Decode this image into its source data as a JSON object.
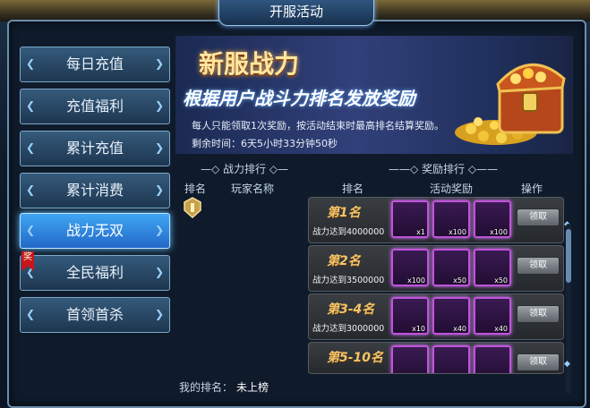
{
  "window": {
    "title": "开服活动"
  },
  "sidebar": {
    "items": [
      {
        "label": "每日充值",
        "active": false
      },
      {
        "label": "充值福利",
        "active": false
      },
      {
        "label": "累计充值",
        "active": false
      },
      {
        "label": "累计消费",
        "active": false
      },
      {
        "label": "战力无双",
        "active": true
      },
      {
        "label": "全民福利",
        "active": false,
        "badge": "奖"
      },
      {
        "label": "首领首杀",
        "active": false
      }
    ]
  },
  "banner": {
    "title": "新服战力",
    "subtitle": "根据用户战斗力排名发放奖励",
    "desc": "每人只能领取1次奖励，按活动结束时最高排名结算奖励。",
    "remaining_label": "剩余时间：",
    "remaining_value": "6天5小时33分钟50秒"
  },
  "left_panel": {
    "section_title": "战力排行",
    "col_rank": "排名",
    "col_player": "玩家名称"
  },
  "reward_panel": {
    "section_title": "奖励排行",
    "col_rank": "排名",
    "col_reward": "活动奖励",
    "col_action": "操作",
    "rows": [
      {
        "rank": "第1名",
        "requirement": "战力达到4000000",
        "items": [
          {
            "icon": "hero-portrait-icon",
            "count": "x1"
          },
          {
            "icon": "gold-gem-icon",
            "count": "x100"
          },
          {
            "icon": "green-gem-icon",
            "count": "x100"
          }
        ],
        "action": "领取"
      },
      {
        "rank": "第2名",
        "requirement": "战力达到3500000",
        "items": [
          {
            "icon": "red-book-icon",
            "count": "x100"
          },
          {
            "icon": "gold-gem-icon",
            "count": "x50"
          },
          {
            "icon": "green-gem-icon",
            "count": "x50"
          }
        ],
        "action": "领取"
      },
      {
        "rank": "第3-4名",
        "requirement": "战力达到3000000",
        "items": [
          {
            "icon": "orange-shield-icon",
            "count": "x10"
          },
          {
            "icon": "gold-gem-icon",
            "count": "x40"
          },
          {
            "icon": "green-gem-icon",
            "count": "x40"
          }
        ],
        "action": "领取"
      },
      {
        "rank": "第5-10名",
        "requirement": "",
        "items": [
          {
            "icon": "red-armor-icon",
            "count": ""
          },
          {
            "icon": "gold-gem-icon",
            "count": ""
          },
          {
            "icon": "green-gem-icon",
            "count": ""
          }
        ],
        "action": "领取"
      }
    ]
  },
  "my_rank": {
    "label": "我的排名：",
    "value": "未上榜"
  },
  "colors": {
    "accent_blue": "#2f86e0",
    "gold": "#f2c56a",
    "item_border": "#c054d8"
  }
}
